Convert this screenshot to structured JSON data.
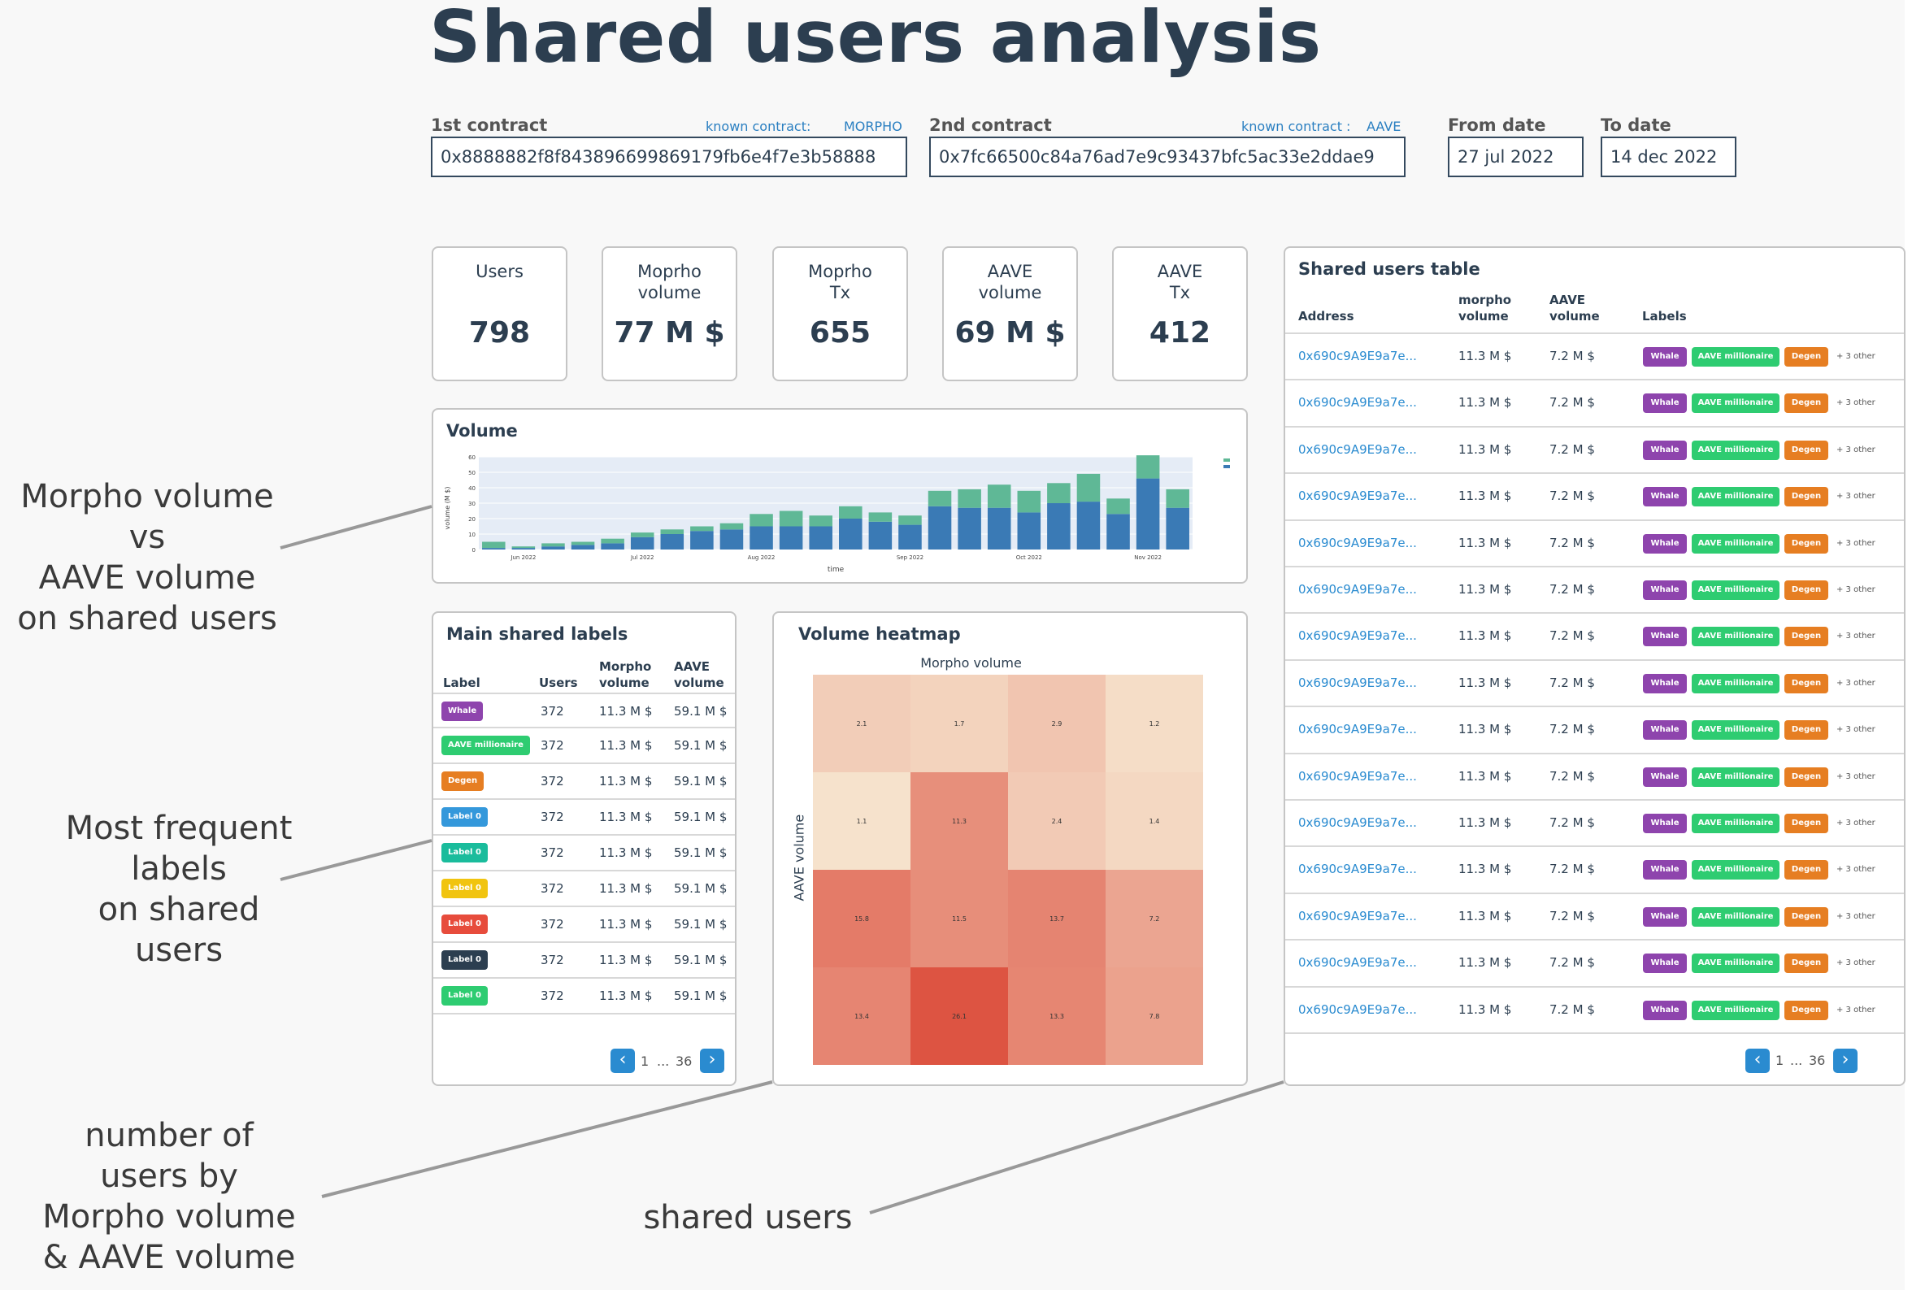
{
  "title": "Shared users analysis",
  "filters": {
    "c1_label": "1st contract",
    "c1_known_label": "known contract:",
    "c1_known_value": "MORPHO",
    "c1_value": "0x8888882f8f843896699869179fb6e4f7e3b58888",
    "c2_label": "2nd contract",
    "c2_known_label": "known contract :",
    "c2_known_value": "AAVE",
    "c2_value": "0x7fc66500c84a76ad7e9c93437bfc5ac33e2ddae9",
    "from_label": "From date",
    "from_value": "27 jul 2022",
    "to_label": "To date",
    "to_value": "14 dec 2022"
  },
  "kpis": [
    {
      "label": "Users",
      "value": "798"
    },
    {
      "label": "Moprho volume",
      "value": "77 M $"
    },
    {
      "label": "Moprho Tx",
      "value": "655"
    },
    {
      "label": "AAVE volume",
      "value": "69 M $"
    },
    {
      "label": "AAVE Tx",
      "value": "412"
    }
  ],
  "volume_card": {
    "title": "Volume"
  },
  "chart_data": [
    {
      "type": "bar",
      "stacked": true,
      "title": "Volume",
      "xlabel": "time",
      "ylabel": "volume (M $)",
      "ylim": [
        0,
        60
      ],
      "yticks": [
        0,
        10,
        20,
        30,
        40,
        50,
        60
      ],
      "xticks": [
        "Jun 2022",
        "Jul 2022",
        "Aug 2022",
        "Sep 2022",
        "Oct 2022",
        "Nov 2022"
      ],
      "grid": true,
      "legend": "top-right",
      "series": [
        {
          "color": "#3a7ab5",
          "values": [
            1,
            1,
            2,
            3,
            4,
            8,
            10,
            12,
            13,
            15,
            15,
            15,
            20,
            18,
            16,
            28,
            27,
            27,
            24,
            30,
            31,
            23,
            46,
            27
          ]
        },
        {
          "color": "#5fb896",
          "values": [
            4,
            1,
            2,
            2,
            3,
            3,
            3,
            3,
            4,
            8,
            10,
            7,
            8,
            6,
            6,
            10,
            12,
            15,
            14,
            13,
            18,
            10,
            15,
            12
          ]
        }
      ]
    },
    {
      "type": "heatmap",
      "title": "Volume heatmap",
      "xlabel": "Morpho volume",
      "ylabel": "AAVE volume",
      "values": [
        [
          2.1,
          1.7,
          2.9,
          1.2
        ],
        [
          1.1,
          11.3,
          2.4,
          1.4
        ],
        [
          15.8,
          11.5,
          13.7,
          7.2
        ],
        [
          13.4,
          26.1,
          13.3,
          7.8
        ]
      ]
    }
  ],
  "labels_table": {
    "title": "Main shared labels",
    "headers": [
      "Label",
      "Users",
      "Morpho volume",
      "AAVE volume"
    ],
    "rows": [
      {
        "label": "Whale",
        "color": "#8e44ad",
        "users": "372",
        "morpho": "11.3 M $",
        "aave": "59.1 M $"
      },
      {
        "label": "AAVE millionaire",
        "color": "#2ecc71",
        "users": "372",
        "morpho": "11.3 M $",
        "aave": "59.1 M $"
      },
      {
        "label": "Degen",
        "color": "#e67e22",
        "users": "372",
        "morpho": "11.3 M $",
        "aave": "59.1 M $"
      },
      {
        "label": "Label 0",
        "color": "#3498db",
        "users": "372",
        "morpho": "11.3 M $",
        "aave": "59.1 M $"
      },
      {
        "label": "Label 0",
        "color": "#1abc9c",
        "users": "372",
        "morpho": "11.3 M $",
        "aave": "59.1 M $"
      },
      {
        "label": "Label 0",
        "color": "#f1c40f",
        "users": "372",
        "morpho": "11.3 M $",
        "aave": "59.1 M $"
      },
      {
        "label": "Label 0",
        "color": "#e74c3c",
        "users": "372",
        "morpho": "11.3 M $",
        "aave": "59.1 M $"
      },
      {
        "label": "Label 0",
        "color": "#2c3e50",
        "users": "372",
        "morpho": "11.3 M $",
        "aave": "59.1 M $"
      },
      {
        "label": "Label 0",
        "color": "#2ecc71",
        "users": "372",
        "morpho": "11.3 M $",
        "aave": "59.1 M $"
      }
    ],
    "pagination": {
      "first": "1",
      "ellipsis": "...",
      "last": "36"
    }
  },
  "heatmap_card": {
    "title": "Volume heatmap",
    "xlabel": "Morpho volume",
    "ylabel": "AAVE volume"
  },
  "shared_table": {
    "title": "Shared users table",
    "headers": [
      "Address",
      "morpho volume",
      "AAVE volume",
      "Labels"
    ],
    "row": {
      "address": "0x690c9A9E9a7e...",
      "morpho": "11.3 M $",
      "aave": "7.2 M $",
      "b1": "Whale",
      "b2": "AAVE millionaire",
      "b3": "Degen",
      "other": "+ 3 other"
    },
    "row_count": 15,
    "pagination": {
      "first": "1",
      "ellipsis": "...",
      "last": "36"
    }
  },
  "annotations": {
    "volume": [
      "Morpho volume",
      "vs",
      "AAVE volume",
      "on shared users"
    ],
    "labels": [
      "Most frequent",
      "labels",
      "on shared",
      "users"
    ],
    "heatmap": [
      "number of",
      "users by",
      "Morpho volume",
      "& AAVE volume"
    ],
    "shared": [
      "shared users"
    ]
  },
  "colors": {
    "dark": "#2c3e50",
    "link": "#2a8bd0",
    "morpho_bar": "#3a7ab5",
    "aave_bar": "#5fb896",
    "whale": "#8e44ad",
    "millionaire": "#2ecc71",
    "degen": "#e67e22"
  }
}
